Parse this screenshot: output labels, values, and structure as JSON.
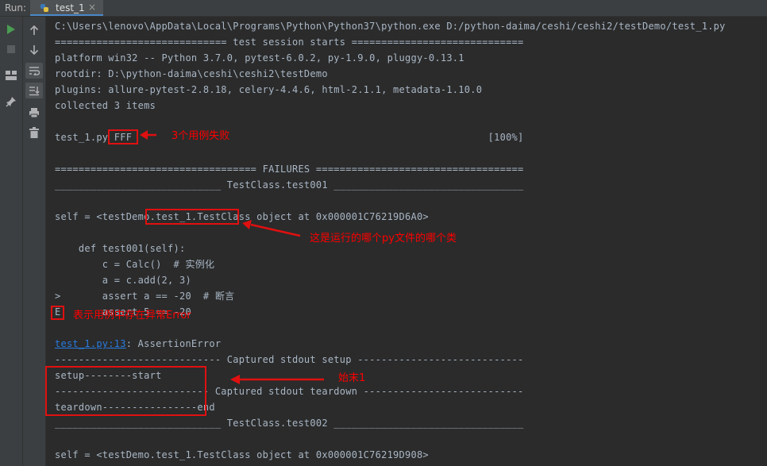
{
  "toolbar": {
    "run_label": "Run:",
    "tab_label": "test_1",
    "tab_close": "×"
  },
  "console": {
    "lines": [
      "C:\\Users\\lenovo\\AppData\\Local\\Programs\\Python\\Python37\\python.exe D:/python-daima/ceshi/ceshi2/testDemo/test_1.py",
      "============================= test session starts =============================",
      "platform win32 -- Python 3.7.0, pytest-6.0.2, py-1.9.0, pluggy-0.13.1",
      "rootdir: D:\\python-daima\\ceshi\\ceshi2\\testDemo",
      "plugins: allure-pytest-2.8.18, celery-4.4.6, html-2.1.1, metadata-1.10.0",
      "collected 3 items",
      "",
      "test_1.py FFF                                                            [100%]",
      "",
      "================================== FAILURES ===================================",
      "____________________________ TestClass.test001 ________________________________",
      "",
      "self = <testDemo.test_1.TestClass object at 0x000001C76219D6A0>",
      "",
      "    def test001(self):",
      "        c = Calc()  # 实例化",
      "        a = c.add(2, 3)",
      ">       assert a == -20  # 断言",
      "E       assert 5 == -20",
      "",
      "test_1.py:13: AssertionError",
      "---------------------------- Captured stdout setup ----------------------------",
      "setup--------start",
      "-------------------------- Captured stdout teardown ---------------------------",
      "teardown----------------end",
      "____________________________ TestClass.test002 ________________________________",
      "",
      "self = <testDemo.test_1.TestClass object at 0x000001C76219D908>"
    ],
    "link_text": "test_1.py:13",
    "link_rest": ": AssertionError"
  },
  "annotations": {
    "fff_note": "3个用例失败",
    "class_note": "这是运行的哪个py文件的哪个类",
    "error_note": "表示用例中存在异常Error",
    "output_note": "始末1"
  },
  "icons": {
    "tab": "python-file-icon",
    "left1": [
      "run-icon",
      "stop-icon",
      "layout-icon",
      "pin-icon"
    ],
    "left2": [
      "up-arrow-icon",
      "down-arrow-icon",
      "soft-wrap-icon",
      "scroll-to-end-icon",
      "print-icon",
      "trash-icon"
    ]
  },
  "colors": {
    "background": "#2b2b2b",
    "text": "#a9b7c6",
    "link": "#287bde",
    "annotation": "#ff0000",
    "run_green": "#499c54"
  }
}
